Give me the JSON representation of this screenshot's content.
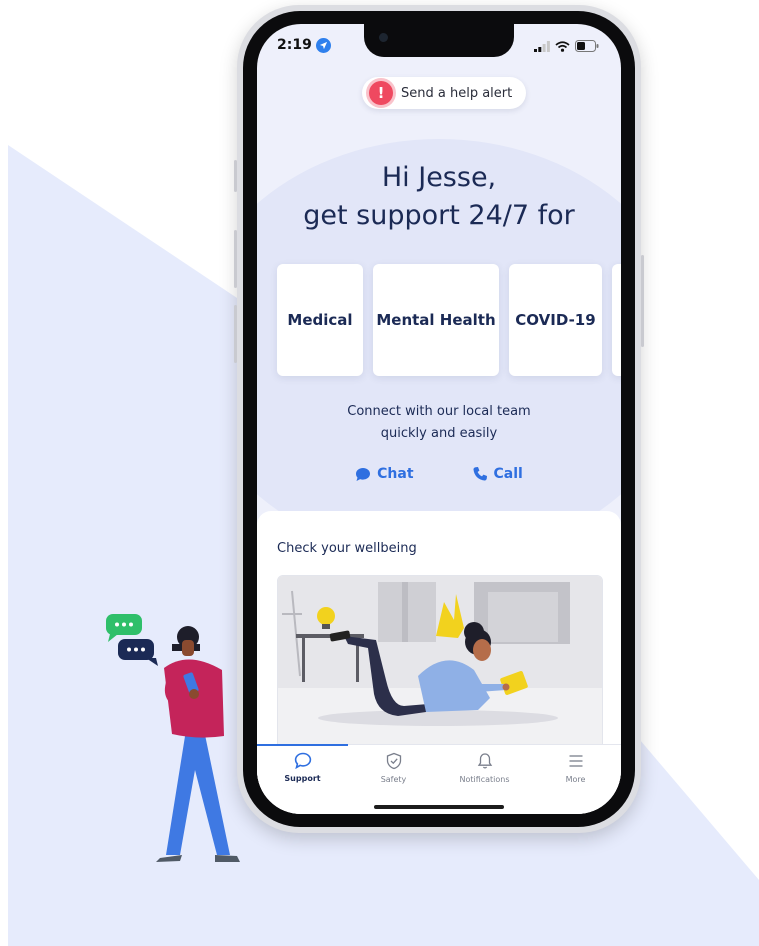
{
  "status_bar": {
    "time": "2:19"
  },
  "help_alert": {
    "icon": "!",
    "label": "Send a help alert"
  },
  "greeting": {
    "line1": "Hi Jesse,",
    "line2": "get support 24/7 for"
  },
  "categories": [
    {
      "label": "Medical"
    },
    {
      "label": "Mental Health"
    },
    {
      "label": "COVID-19"
    }
  ],
  "connect": {
    "line1": "Connect with our local team",
    "line2": "quickly and easily"
  },
  "actions": {
    "chat": "Chat",
    "call": "Call"
  },
  "wellbeing": {
    "title": "Check your wellbeing"
  },
  "tabbar": {
    "active": "Support",
    "items": [
      {
        "label": "Support",
        "icon": "chat-bubble-icon"
      },
      {
        "label": "Safety",
        "icon": "shield-check-icon"
      },
      {
        "label": "Notifications",
        "icon": "bell-icon"
      },
      {
        "label": "More",
        "icon": "menu-icon"
      }
    ]
  },
  "colors": {
    "accent": "#2f6fe0",
    "alert": "#ef4960",
    "heading": "#1b2a55",
    "screen_bg": "#eef0fb",
    "background_shape": "#e6ebfc"
  }
}
